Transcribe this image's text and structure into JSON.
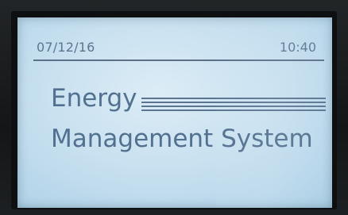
{
  "status_bar": {
    "date": "07/12/16",
    "time": "10:40"
  },
  "splash": {
    "title_line1": "Energy",
    "title_line2": "Management System"
  },
  "colors": {
    "lcd_background": "#c9e1f0",
    "lcd_text": "#536d86",
    "bezel": "#141617"
  }
}
